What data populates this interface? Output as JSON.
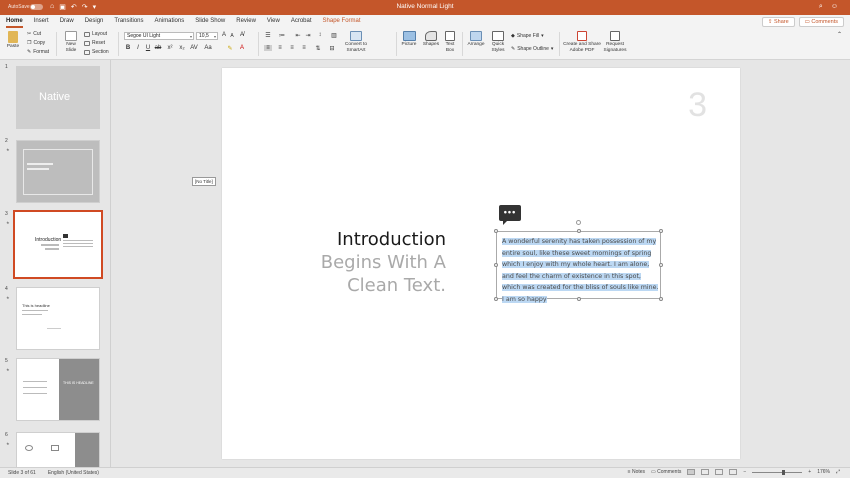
{
  "titlebar": {
    "autosave": "AutoSave",
    "autosave_state": "OFF",
    "doc_title": "Native Normal Light"
  },
  "tabs": [
    "Home",
    "Insert",
    "Draw",
    "Design",
    "Transitions",
    "Animations",
    "Slide Show",
    "Review",
    "View",
    "Acrobat",
    "Shape Format"
  ],
  "share": {
    "share": "Share",
    "comments": "Comments"
  },
  "ribbon": {
    "paste": "Paste",
    "cut": "Cut",
    "copy": "Copy",
    "format": "Format",
    "new_slide": "New Slide",
    "layout": "Layout",
    "reset": "Reset",
    "section": "Section",
    "font_name": "Segoe UI Light",
    "font_size": "10,5",
    "convert_smartart": "Convert to SmartArt",
    "picture": "Picture",
    "shapes": "Shapes",
    "text_box": "Text Box",
    "arrange": "Arrange",
    "quick_styles": "Quick Styles",
    "shape_fill": "Shape Fill",
    "shape_outline": "Shape Outline",
    "create_share_pdf": "Create and Share Adobe PDF",
    "request_signatures": "Request Signatures"
  },
  "thumbs": [
    {
      "num": "1",
      "title": "Native"
    },
    {
      "num": "2"
    },
    {
      "num": "3",
      "title": "Introduction"
    },
    {
      "num": "4",
      "title": "This is headline"
    },
    {
      "num": "5",
      "title": "THIS IS HEADLINE"
    },
    {
      "num": "6"
    }
  ],
  "slide": {
    "number": "3",
    "no_title": "[No Title]",
    "line1": "Introduction",
    "line2": "Begins With A",
    "line3": "Clean Text.",
    "body_lines": [
      "A wonderful serenity has taken possession of my",
      "entire soul, like these sweet mornings of spring",
      "which I enjoy with my whole heart. I am alone,",
      "and feel the charm of existence in this spot,",
      "which was created for the bliss of souls like mine.",
      "I am so happy"
    ]
  },
  "status": {
    "slide_of": "Slide 3 of 61",
    "language": "English (United States)",
    "notes": "Notes",
    "comments": "Comments",
    "zoom": "176%"
  },
  "colors": {
    "accent": "#c4562a",
    "selection": "#bcd8f3"
  }
}
